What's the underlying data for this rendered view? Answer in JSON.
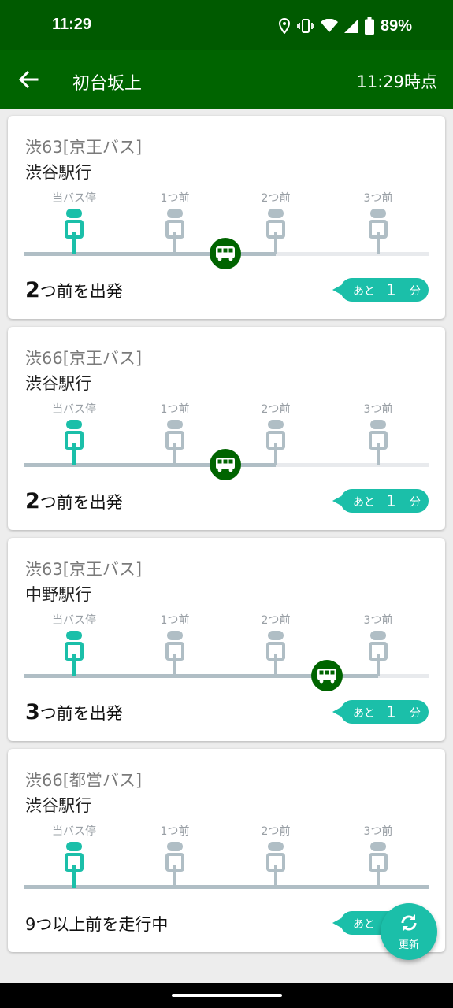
{
  "status_bar": {
    "time": "11:29",
    "battery": "89%"
  },
  "app_bar": {
    "title": "初台坂上",
    "as_of": "11:29時点"
  },
  "stop_labels": [
    "当バス停",
    "1つ前",
    "2つ前",
    "3つ前"
  ],
  "cards": [
    {
      "route": "渋63[京王バス]",
      "destination": "渋谷駅行",
      "status_num": "2",
      "status_text": "つ前を出発",
      "eta_prefix": "あと",
      "eta_value": "1",
      "eta_unit": "分",
      "bus_position_stops_before": 1.5
    },
    {
      "route": "渋66[京王バス]",
      "destination": "渋谷駅行",
      "status_num": "2",
      "status_text": "つ前を出発",
      "eta_prefix": "あと",
      "eta_value": "1",
      "eta_unit": "分",
      "bus_position_stops_before": 1.5
    },
    {
      "route": "渋63[京王バス]",
      "destination": "中野駅行",
      "status_num": "3",
      "status_text": "つ前を出発",
      "eta_prefix": "あと",
      "eta_value": "1",
      "eta_unit": "分",
      "bus_position_stops_before": 2.5
    },
    {
      "route": "渋66[都営バス]",
      "destination": "渋谷駅行",
      "status_num": "",
      "status_text": "9つ以上前を走行中",
      "eta_prefix": "あと",
      "eta_value": "",
      "eta_unit": "",
      "bus_position_stops_before": null
    }
  ],
  "fab": {
    "label": "更新"
  },
  "colors": {
    "primary": "#006400",
    "status_bar": "#005a00",
    "accent": "#1bbfa9",
    "inactive": "#b0bec5"
  }
}
